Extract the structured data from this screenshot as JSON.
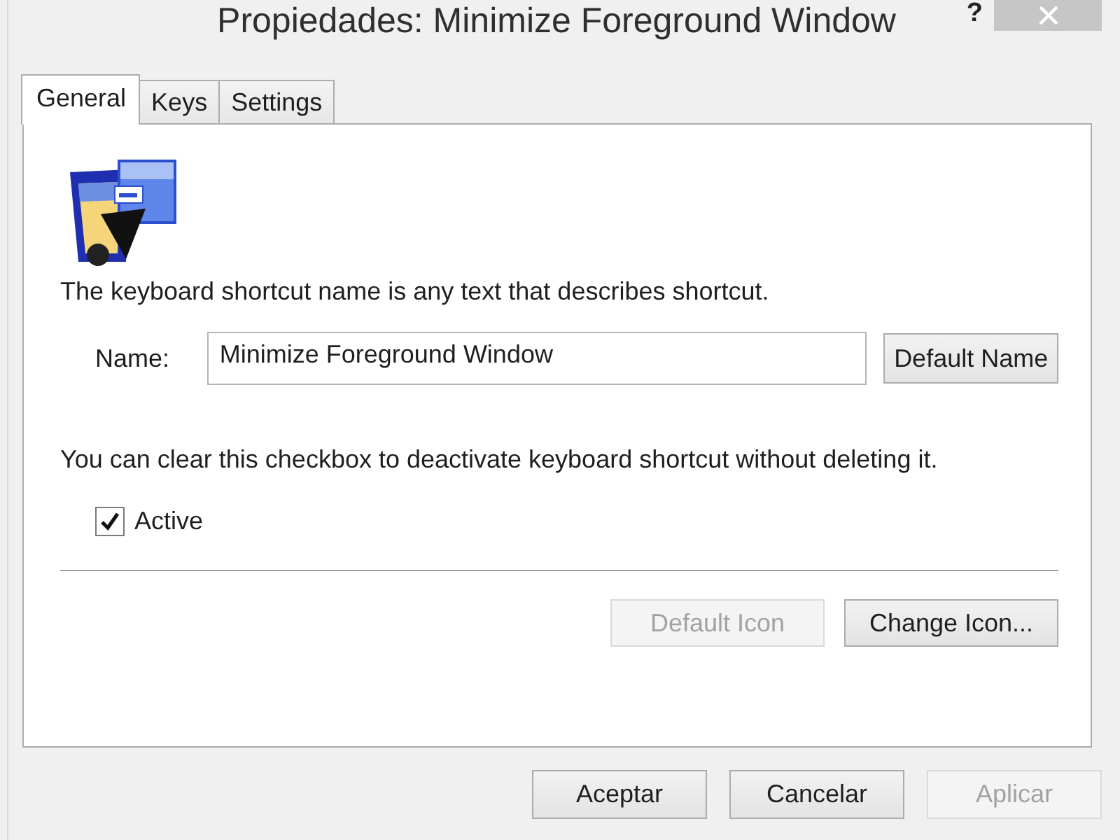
{
  "window": {
    "title": "Propiedades: Minimize Foreground Window",
    "help": "?"
  },
  "tabs": [
    {
      "label": "General",
      "selected": true
    },
    {
      "label": "Keys",
      "selected": false
    },
    {
      "label": "Settings",
      "selected": false
    }
  ],
  "general": {
    "description": "The keyboard shortcut name is any text that describes shortcut.",
    "name_label": "Name:",
    "name_value": "Minimize Foreground Window",
    "default_name_button": "Default Name",
    "active_hint": "You can clear this checkbox to deactivate keyboard shortcut without deleting it.",
    "active": {
      "label": "Active",
      "checked": true
    },
    "icon_buttons": [
      {
        "label": "Default Icon",
        "disabled": true
      },
      {
        "label": "Change Icon...",
        "disabled": false
      }
    ]
  },
  "buttons": [
    {
      "label": "Aceptar",
      "disabled": false
    },
    {
      "label": "Cancelar",
      "disabled": false
    },
    {
      "label": "Aplicar",
      "disabled": true
    }
  ]
}
